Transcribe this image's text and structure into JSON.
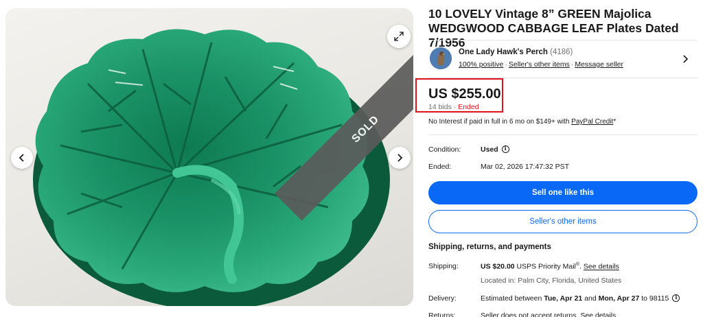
{
  "gallery": {
    "sold_label": "SOLD"
  },
  "listing": {
    "title": "10 LOVELY Vintage 8” GREEN Majolica WEDGWOOD CABBAGE LEAF Plates Dated 7/1956"
  },
  "seller": {
    "name": "One Lady Hawk's Perch",
    "feedback_count": "(4186)",
    "positive": "100% positive",
    "other_items": "Seller's other items",
    "message": "Message seller"
  },
  "price": {
    "amount": "US $255.00",
    "bids": "14 bids",
    "separator": "·",
    "status": "Ended",
    "credit_text": "No Interest if paid in full in 6 mo on $149+ with",
    "credit_link": "PayPal Credit",
    "credit_suffix": "*"
  },
  "details": {
    "condition_label": "Condition:",
    "condition_value": "Used",
    "ended_label": "Ended:",
    "ended_value": "Mar 02, 2026 17:47:32 PST"
  },
  "actions": {
    "sell_one": "Sell one like this",
    "seller_items": "Seller's other items"
  },
  "shipping": {
    "section_title": "Shipping, returns, and payments",
    "shipping_label": "Shipping:",
    "shipping_price": "US $20.00",
    "shipping_service": "USPS Priority Mail",
    "shipping_reg": "®",
    "shipping_link": "See details",
    "location": "Located in: Palm City, Florida, United States",
    "delivery_label": "Delivery:",
    "delivery_prefix": "Estimated between",
    "delivery_start": "Tue, Apr 21",
    "delivery_and": "and",
    "delivery_end": "Mon, Apr 27",
    "delivery_suffix": "to 98115",
    "returns_label": "Returns:",
    "returns_value": "Seller does not accept returns.",
    "returns_link": "See details"
  },
  "colors": {
    "accent_blue": "#0968f6",
    "ended_red": "#e0101b",
    "plate_green": "#1f9a6e"
  }
}
